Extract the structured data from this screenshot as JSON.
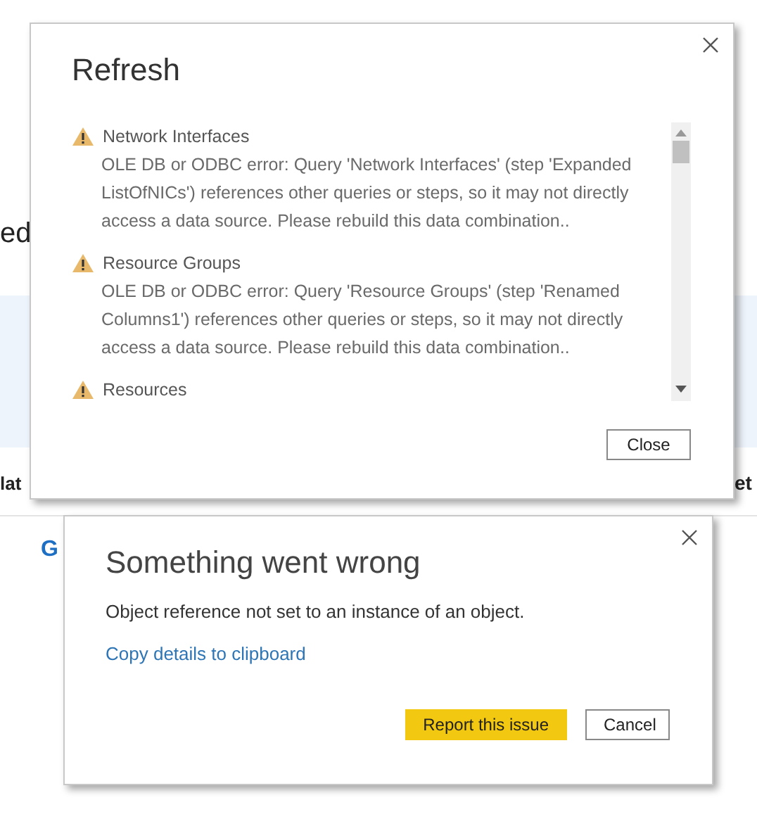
{
  "background": {
    "fragments": [
      {
        "kind": "subheading",
        "text": "ed"
      },
      {
        "kind": "label-left",
        "text": "lat"
      },
      {
        "kind": "label-right",
        "text": "et"
      },
      {
        "kind": "link",
        "text": "G"
      }
    ]
  },
  "refresh_dialog": {
    "title": "Refresh",
    "items": [
      {
        "name": "Network Interfaces",
        "message": "OLE DB or ODBC error: Query 'Network Interfaces' (step 'Expanded ListOfNICs') references other queries or steps, so it may not directly access a data source. Please rebuild this data combination.."
      },
      {
        "name": "Resource Groups",
        "message": "OLE DB or ODBC error: Query 'Resource Groups' (step 'Renamed Columns1') references other queries or steps, so it may not directly access a data source. Please rebuild this data combination.."
      },
      {
        "name": "Resources"
      }
    ],
    "buttons": [
      "Close"
    ]
  },
  "error_dialog": {
    "title": "Something went wrong",
    "message": "Object reference not set to an instance of an object.",
    "link": "Copy details to clipboard",
    "buttons": [
      {
        "label": "Report this issue",
        "kind": "primary"
      },
      {
        "label": "Cancel",
        "kind": "secondary"
      }
    ]
  }
}
